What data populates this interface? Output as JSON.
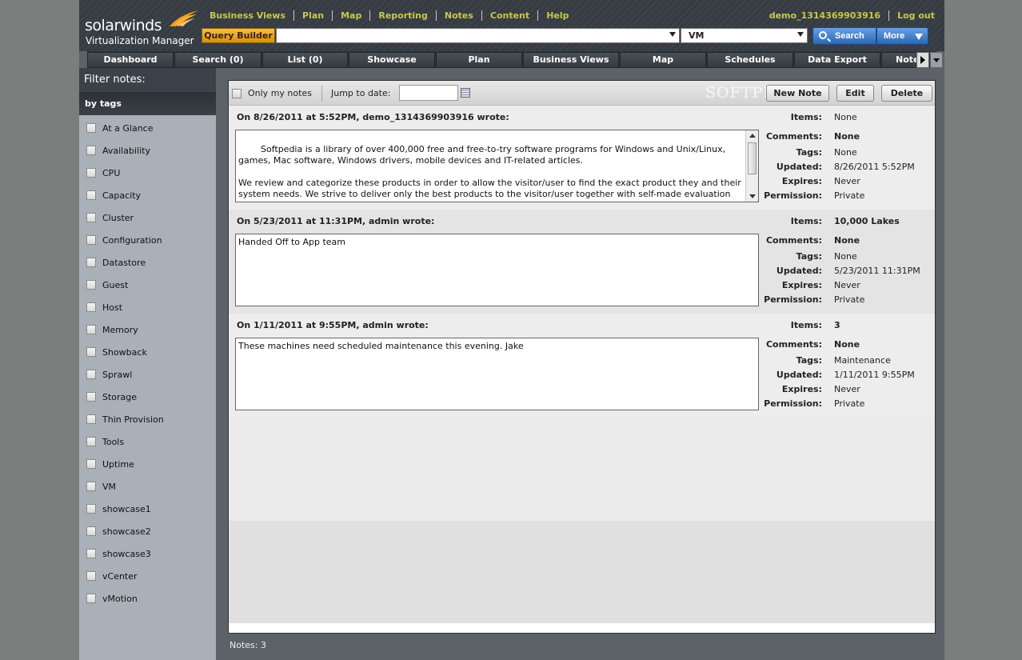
{
  "brand": {
    "name": "solarwinds",
    "product": "Virtualization Manager"
  },
  "topnav": [
    "Business Views",
    "Plan",
    "Map",
    "Reporting",
    "Notes",
    "Content",
    "Help"
  ],
  "user": {
    "name": "demo_1314369903916",
    "logout": "Log out"
  },
  "search": {
    "query_builder": "Query Builder",
    "query": "",
    "type": "VM",
    "search_label": "Search",
    "more_label": "More"
  },
  "tabs": [
    "Dashboard",
    "Search (0)",
    "List (0)",
    "Showcase",
    "Plan",
    "Business Views",
    "Map",
    "Schedules",
    "Data Export",
    "Notes"
  ],
  "sidebar": {
    "title": "Filter notes:",
    "section": "by tags",
    "tags": [
      "At a Glance",
      "Availability",
      "CPU",
      "Capacity",
      "Cluster",
      "Configuration",
      "Datastore",
      "Guest",
      "Host",
      "Memory",
      "Showback",
      "Sprawl",
      "Storage",
      "Thin Provision",
      "Tools",
      "Uptime",
      "VM",
      "showcase1",
      "showcase2",
      "showcase3",
      "vCenter",
      "vMotion"
    ]
  },
  "toolbar": {
    "only_my_notes": "Only my notes",
    "jump_to_date": "Jump to date:",
    "date_value": "",
    "new_note": "New Note",
    "edit": "Edit",
    "delete": "Delete",
    "watermark": "SOFTPEDIA"
  },
  "labels": {
    "items": "Items:",
    "comments": "Comments:",
    "tags": "Tags:",
    "updated": "Updated:",
    "expires": "Expires:",
    "permission": "Permission:"
  },
  "notes": [
    {
      "header": "On 8/26/2011 at 5:52PM, demo_1314369903916 wrote:",
      "body": "Softpedia is a library of over 400,000 free and free-to-try software programs for Windows and Unix/Linux, games, Mac software, Windows drivers, mobile devices and IT-related articles.\n\nWe review and categorize these products in order to allow the visitor/user to find the exact product they and their system needs. We strive to deliver only the best products to the visitor/user together with self-made evaluation and review notes.",
      "items": "None",
      "comments": "None",
      "tags": "None",
      "updated": "8/26/2011 5:52PM",
      "expires": "Never",
      "permission": "Private"
    },
    {
      "header": "On 5/23/2011 at 11:31PM, admin wrote:",
      "body": "Handed Off to App team",
      "items": "10,000 Lakes",
      "comments": "None",
      "tags": "None",
      "updated": "5/23/2011 11:31PM",
      "expires": "Never",
      "permission": "Private"
    },
    {
      "header": "On 1/11/2011 at 9:55PM, admin wrote:",
      "body": "These machines need scheduled maintenance this evening. Jake",
      "items": "3",
      "comments": "None",
      "tags": "Maintenance",
      "updated": "1/11/2011 9:55PM",
      "expires": "Never",
      "permission": "Private"
    }
  ],
  "footer": {
    "count": "Notes: 3"
  }
}
